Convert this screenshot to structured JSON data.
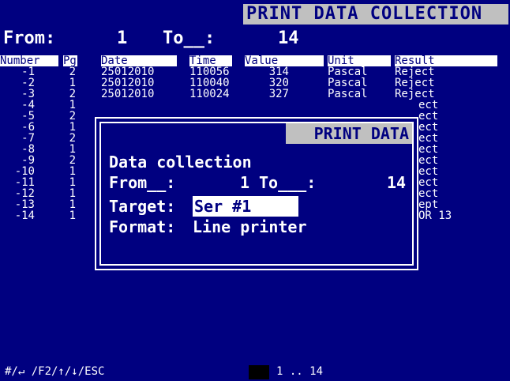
{
  "title": "PRINT DATA COLLECTION",
  "range": {
    "from_label": "From:",
    "from_value": "1",
    "to_label": "To__:",
    "to_value": "14"
  },
  "table": {
    "headers": [
      "Number",
      "Pg",
      "Date",
      "Time",
      "Value",
      "Unit",
      "Result"
    ],
    "rows": [
      {
        "number": "-1",
        "pg": "2",
        "date": "25012010",
        "time": "110056",
        "value": "314",
        "unit": "Pascal",
        "result": "Reject"
      },
      {
        "number": "-2",
        "pg": "1",
        "date": "25012010",
        "time": "110040",
        "value": "320",
        "unit": "Pascal",
        "result": "Reject"
      },
      {
        "number": "-3",
        "pg": "2",
        "date": "25012010",
        "time": "110024",
        "value": "327",
        "unit": "Pascal",
        "result": "Reject"
      },
      {
        "number": "-4",
        "pg": "1",
        "result": "ect"
      },
      {
        "number": "-5",
        "pg": "2",
        "result": "ect"
      },
      {
        "number": "-6",
        "pg": "1",
        "result": "ect"
      },
      {
        "number": "-7",
        "pg": "2",
        "result": "ect"
      },
      {
        "number": "-8",
        "pg": "1",
        "result": "ect"
      },
      {
        "number": "-9",
        "pg": "2",
        "result": "ect"
      },
      {
        "number": "-10",
        "pg": "1",
        "result": "ect"
      },
      {
        "number": "-11",
        "pg": "1",
        "result": "ect"
      },
      {
        "number": "-12",
        "pg": "1",
        "result": "ect"
      },
      {
        "number": "-13",
        "pg": "1",
        "result": "ept"
      },
      {
        "number": "-14",
        "pg": "1",
        "result": "OR 13"
      }
    ]
  },
  "dialog": {
    "title": "PRINT DATA",
    "heading": "Data collection",
    "from_label": "From__:",
    "from_value": "1",
    "to_label": "To___:",
    "to_value": "14",
    "target_label": "Target:",
    "target_value": "Ser #1",
    "format_label": "Format:",
    "format_value": "Line printer"
  },
  "status": {
    "keys": "#/↵ /F2/↑/↓/ESC",
    "range": "1 .. 14"
  },
  "colors": {
    "background": "#000080",
    "highlight": "#c0c0c0",
    "text": "#ffffff"
  }
}
